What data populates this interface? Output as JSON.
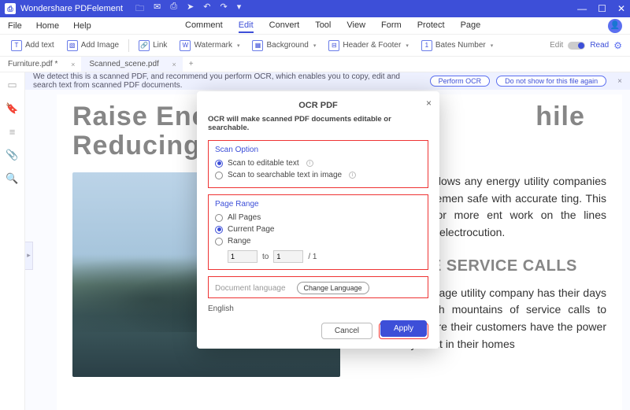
{
  "titlebar": {
    "app": "Wondershare PDFelement"
  },
  "menubar": {
    "left": [
      "File",
      "Home",
      "Help"
    ],
    "right": [
      "Comment",
      "Edit",
      "Convert",
      "Tool",
      "View",
      "Form",
      "Protect",
      "Page"
    ],
    "active": "Edit"
  },
  "ribbon": {
    "items": [
      {
        "icon": "T",
        "label": "Add text"
      },
      {
        "icon": "▧",
        "label": "Add Image"
      },
      {
        "icon": "🔗",
        "label": "Link"
      },
      {
        "icon": "W",
        "label": "Watermark"
      },
      {
        "icon": "▦",
        "label": "Background"
      },
      {
        "icon": "⊟",
        "label": "Header & Footer"
      },
      {
        "icon": "1",
        "label": "Bates Number"
      }
    ],
    "edit": "Edit",
    "read": "Read"
  },
  "tabs": [
    {
      "label": "Furniture.pdf *",
      "active": false
    },
    {
      "label": "Scanned_scene.pdf",
      "active": true
    }
  ],
  "banner": {
    "msg": "We detect this is a scanned PDF, and recommend you perform OCR, which enables you to copy, edit and search text from scanned PDF documents.",
    "btn1": "Perform OCR",
    "btn2": "Do not show for this file again"
  },
  "document": {
    "h1a": "Raise Ener",
    "h1b": "hile",
    "h2a": "Reducing",
    "p1": "ement allows any energy utility companies to keep emen safe with accurate ting. This allows for more ent work on the lines without f electrocution.",
    "h3": "ROVE SERVICE CALLS",
    "p2": "The average utility company has their days filled with mountains of service calls to make sure their customers have the power they want in their homes"
  },
  "dialog": {
    "title": "OCR PDF",
    "subtitle": "OCR will make scanned PDF documents editable or searchable.",
    "scan": {
      "title": "Scan Option",
      "opt1": "Scan to editable text",
      "opt2": "Scan to searchable text in image"
    },
    "range": {
      "title": "Page Range",
      "opt1": "All Pages",
      "opt2": "Current Page",
      "opt3": "Range",
      "to": "to",
      "total": "/ 1",
      "from_val": "1",
      "to_val": "1"
    },
    "lang": {
      "label": "Document language",
      "btn": "Change Language",
      "value": "English"
    },
    "cancel": "Cancel",
    "apply": "Apply"
  }
}
